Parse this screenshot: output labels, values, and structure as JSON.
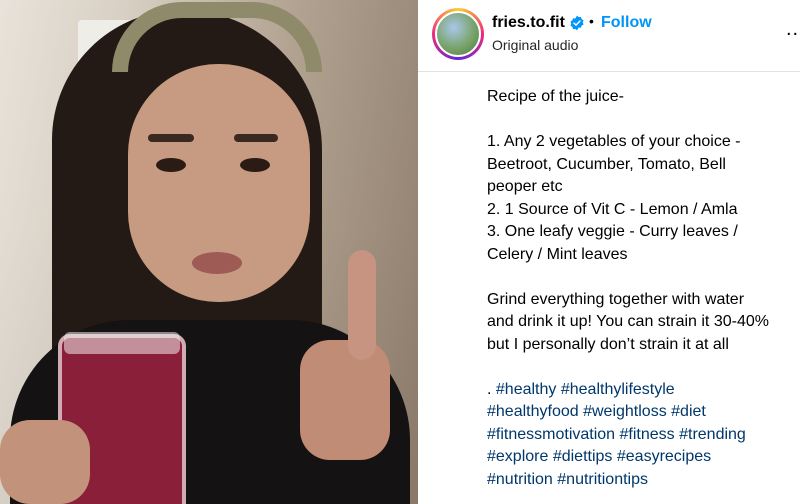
{
  "post": {
    "username": "fries.to.fit",
    "follow_label": "Follow",
    "separator": "•",
    "audio_label": "Original audio",
    "more_label": "..."
  },
  "caption": {
    "title": "Recipe of the juice-",
    "lines1": [
      "1. Any 2 vegetables of your choice -",
      "Beetroot, Cucumber, Tomato, Bell",
      "peoper etc",
      "2. 1 Source of Vit C - Lemon / Amla",
      "3. One leafy veggie - Curry leaves /",
      "Celery / Mint leaves"
    ],
    "lines2": [
      "Grind everything together with water",
      "and drink it up! You can strain it 30-40%",
      "but I personally don’t strain it at all"
    ],
    "tag_prefix": ". ",
    "tags": [
      [
        "#healthy",
        "#healthylifestyle"
      ],
      [
        "#healthyfood",
        "#weightloss",
        "#diet"
      ],
      [
        "#fitnessmotivation",
        "#fitness",
        "#trending"
      ],
      [
        "#explore",
        "#diettips",
        "#easyrecipes"
      ],
      [
        "#nutrition",
        "#nutritiontips"
      ]
    ]
  },
  "icons": {
    "verified": "verified-badge-icon",
    "more": "more-options-icon"
  },
  "colors": {
    "follow": "#0095f6",
    "hashtag": "#00376b",
    "verified": "#0095f6"
  }
}
